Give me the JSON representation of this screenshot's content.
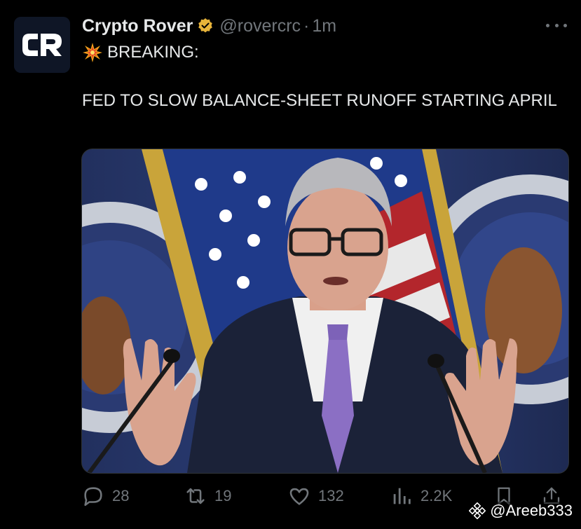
{
  "author": {
    "name": "Crypto Rover",
    "handle": "@rovercrc",
    "separator": "·",
    "time": "1m",
    "avatar_text": "CR",
    "verified_color": "#e8b43a"
  },
  "tweet": {
    "line1": "BREAKING:",
    "line1_icon": "collision-emoji",
    "body": "FED TO SLOW BALANCE-SHEET RUNOFF STARTING APRIL"
  },
  "media": {
    "description_icon": "photo-press-conference"
  },
  "actions": {
    "replies": "28",
    "reposts": "19",
    "likes": "132",
    "views": "2.2K"
  },
  "watermark": {
    "text": "@Areeb333"
  },
  "colors": {
    "background": "#000000",
    "text": "#e7e9ea",
    "secondary": "#71767b"
  }
}
